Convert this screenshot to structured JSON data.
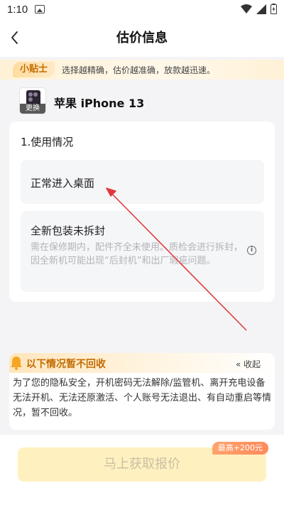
{
  "status_bar": {
    "time": "1:10"
  },
  "nav": {
    "title": "估价信息"
  },
  "tip": {
    "label": "小贴士",
    "text": "选择越精确，估价越准确，放款越迅速。"
  },
  "device": {
    "name": "苹果 iPhone 13",
    "change_label": "更换"
  },
  "usage": {
    "section_title": "1.使用情况",
    "options": [
      {
        "title": "正常进入桌面",
        "desc": ""
      },
      {
        "title": "全新包装未拆封",
        "desc": "需在保修期内，配件齐全未使用。质检会进行拆封，因全新机可能出现“后封机”和出厂瑕疵问题。"
      }
    ]
  },
  "notice": {
    "title": "以下情况暂不回收",
    "collapse_label": "收起",
    "text": "为了您的隐私安全，开机密码无法解除/监管机、离开充电设备无法开机、无法还原激活、个人账号无法退出、有自动重启等情况，暂不回收。"
  },
  "cta": {
    "label": "马上获取报价",
    "badge": "最高+200元"
  },
  "colors": {
    "accent": "#c46b00",
    "annotation_arrow": "#e03a3a",
    "cta_bg": "#fff1bf"
  }
}
